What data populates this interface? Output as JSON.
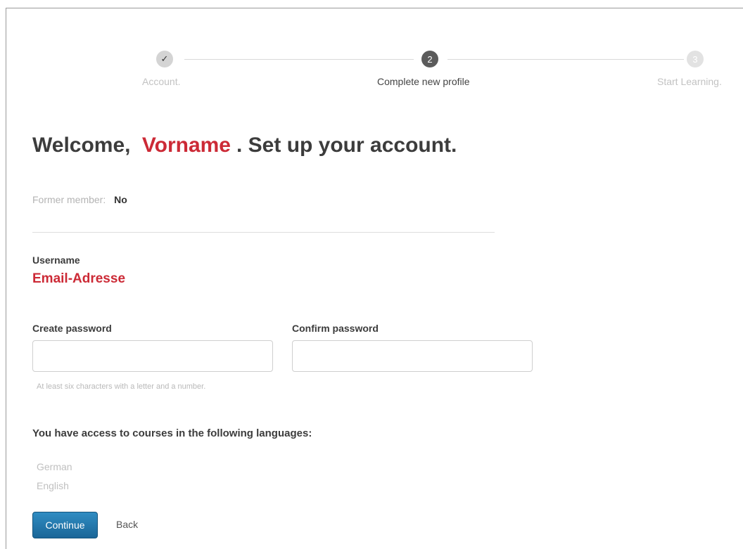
{
  "stepper": {
    "steps": [
      {
        "marker": "✓",
        "label": "Account.",
        "state": "done"
      },
      {
        "marker": "2",
        "label": "Complete new profile",
        "state": "current"
      },
      {
        "marker": "3",
        "label": "Start Learning.",
        "state": "todo"
      }
    ]
  },
  "heading": {
    "prefix": "Welcome,",
    "name": "Vorname",
    "suffix": ". Set up your account."
  },
  "former_member": {
    "label": "Former member:",
    "value": "No"
  },
  "username": {
    "label": "Username",
    "value": "Email-Adresse"
  },
  "password": {
    "create_label": "Create password",
    "create_value": "",
    "confirm_label": "Confirm password",
    "confirm_value": "",
    "hint": "At least six characters with a letter and a number."
  },
  "languages": {
    "title": "You have access to courses in the following languages:",
    "items": [
      "German",
      "English"
    ]
  },
  "actions": {
    "continue_label": "Continue",
    "back_label": "Back"
  },
  "colors": {
    "accent_red": "#cc2a36",
    "primary_button": "#1f73a8",
    "step_current": "#5b5b5b"
  }
}
